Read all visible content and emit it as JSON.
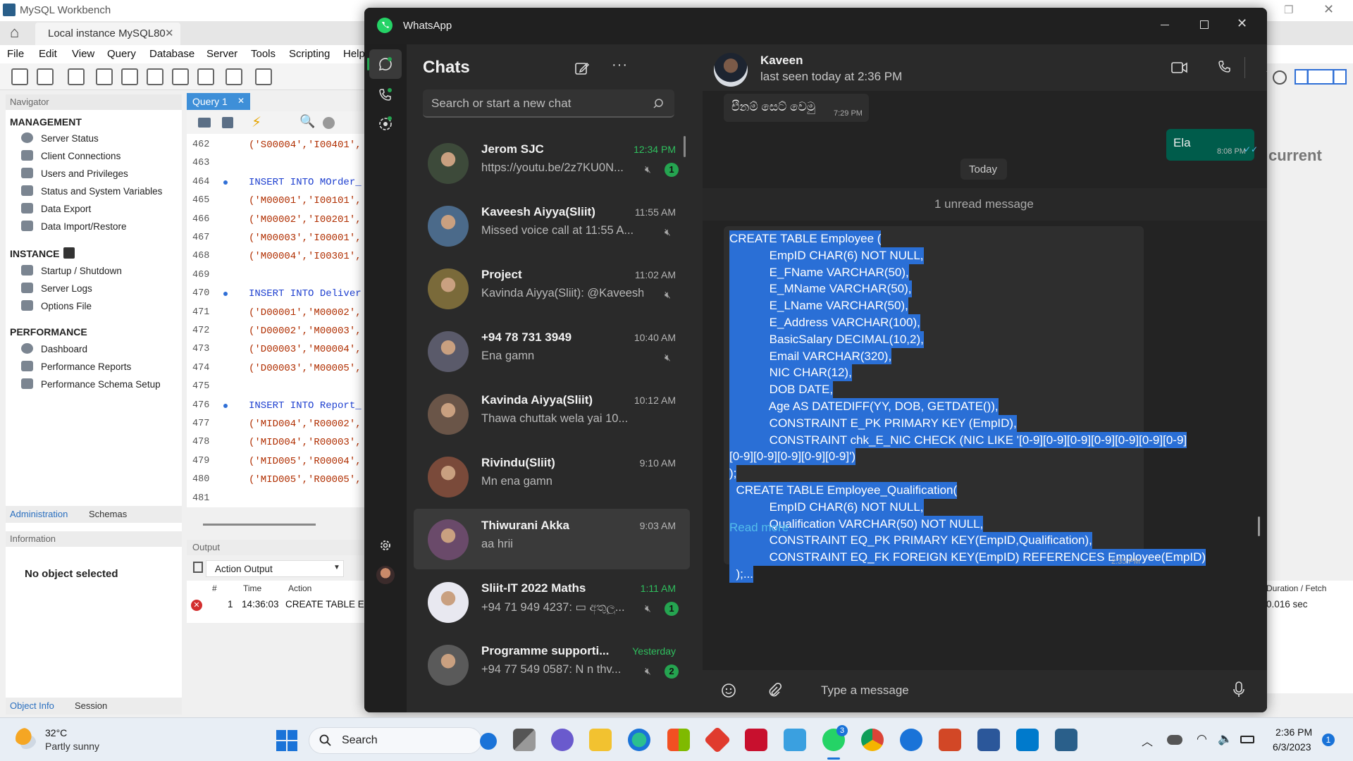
{
  "mysql": {
    "window_title": "MySQL Workbench",
    "instance_tab": "Local instance MySQL80",
    "menu": [
      "File",
      "Edit",
      "View",
      "Query",
      "Database",
      "Server",
      "Tools",
      "Scripting",
      "Help"
    ],
    "navigator_label": "Navigator",
    "query_tab": "Query 1",
    "management_header": "MANAGEMENT",
    "management_items": [
      "Server Status",
      "Client Connections",
      "Users and Privileges",
      "Status and System Variables",
      "Data Export",
      "Data Import/Restore"
    ],
    "instance_header": "INSTANCE",
    "instance_items": [
      "Startup / Shutdown",
      "Server Logs",
      "Options File"
    ],
    "performance_header": "PERFORMANCE",
    "performance_items": [
      "Dashboard",
      "Performance Reports",
      "Performance Schema Setup"
    ],
    "tabs_bottom": [
      "Administration",
      "Schemas"
    ],
    "information_label": "Information",
    "no_object": "No object selected",
    "object_tabs": [
      "Object Info",
      "Session"
    ],
    "line_numbers": [
      "462",
      "463",
      "464",
      "465",
      "466",
      "467",
      "468",
      "469",
      "470",
      "471",
      "472",
      "473",
      "474",
      "475",
      "476",
      "477",
      "478",
      "479",
      "480",
      "481"
    ],
    "code_lines": [
      "('S00004','I00401',",
      "",
      "INSERT INTO MOrder_",
      "('M00001','I00101',",
      "('M00002','I00201',",
      "('M00003','I00001',",
      "('M00004','I00301',",
      "",
      "INSERT INTO Deliver",
      "('D00001','M00002',",
      "('D00002','M00003',",
      "('D00003','M00004',",
      "('D00003','M00005',",
      "",
      "INSERT INTO Report_",
      "('MID004','R00002',",
      "('MID004','R00003',",
      "('MID005','R00004',",
      "('MID005','R00005',",
      ""
    ],
    "output_label": "Output",
    "action_output": "Action Output",
    "out_cols": [
      "#",
      "Time",
      "Action"
    ],
    "out_row": {
      "num": "1",
      "time": "14:36:03",
      "action": "CREATE TABLE E"
    },
    "right_current": "current",
    "right_duration": "Duration / Fetch",
    "right_sec": "0.016 sec"
  },
  "whatsapp": {
    "app_title": "WhatsApp",
    "chats_title": "Chats",
    "search_placeholder": "Search or start a new chat",
    "chats": [
      {
        "name": "Jerom SJC",
        "preview": "https://youtu.be/2z7KU0N...",
        "time": "12:34 PM",
        "unread": "1",
        "green": true
      },
      {
        "name": "Kaveesh Aiyya(Sliit)",
        "preview": "Missed voice call at 11:55 A...",
        "time": "11:55 AM",
        "unread": "",
        "green": false
      },
      {
        "name": "Project",
        "preview": "Kavinda Aiyya(Sliit): @Kaveesh...",
        "time": "11:02 AM",
        "unread": "",
        "green": false
      },
      {
        "name": "+94 78 731 3949",
        "preview": "Ena gamn",
        "time": "10:40 AM",
        "unread": "",
        "green": false
      },
      {
        "name": "Kavinda Aiyya(Sliit)",
        "preview": "Thawa chuttak wela yai 10...",
        "time": "10:12 AM",
        "unread": "",
        "green": false
      },
      {
        "name": "Rivindu(Sliit)",
        "preview": "Mn ena gamn",
        "time": "9:10 AM",
        "unread": "",
        "green": false
      },
      {
        "name": "Thiwurani Akka",
        "preview": "aa hrii",
        "time": "9:03 AM",
        "unread": "",
        "green": false
      },
      {
        "name": "Sliit-IT 2022 Maths",
        "preview": "+94 71 949 4237: ▭ අතුලු...",
        "time": "1:11 AM",
        "unread": "1",
        "green": true
      },
      {
        "name": "Programme supporti...",
        "preview": "+94 77 549 0587: N n thv...",
        "time": "Yesterday",
        "unread": "2",
        "green": true
      }
    ],
    "contact_name": "Kaveen",
    "contact_status": "last seen today at 2:36 PM",
    "msg_in_text": "එිනම් සෙට් වෙමු",
    "msg_in_time": "7:29 PM",
    "msg_out_text": "Ela",
    "msg_out_time": "8:08 PM",
    "today_label": "Today",
    "unread_label": "1 unread message",
    "sql_lines": [
      "CREATE TABLE Employee (",
      "            EmpID CHAR(6) NOT NULL,",
      "            E_FName VARCHAR(50),",
      "            E_MName VARCHAR(50),",
      "            E_LName VARCHAR(50),",
      "            E_Address VARCHAR(100),",
      "            BasicSalary DECIMAL(10,2),",
      "            Email VARCHAR(320),",
      "            NIC CHAR(12),",
      "            DOB DATE,",
      "            Age AS DATEDIFF(YY, DOB, GETDATE()),",
      "            CONSTRAINT E_PK PRIMARY KEY (EmpID),",
      "            CONSTRAINT chk_E_NIC CHECK (NIC LIKE '[0-9][0-9][0-9][0-9][0-9][0-9][0-9]",
      "[0-9][0-9][0-9][0-9][0-9]')",
      ");",
      "  CREATE TABLE Employee_Qualification(",
      "            EmpID CHAR(6) NOT NULL,",
      "            Qualification VARCHAR(50) NOT NULL,",
      "            CONSTRAINT EQ_PK PRIMARY KEY(EmpID,Qualification),",
      "            CONSTRAINT EQ_FK FOREIGN KEY(EmpID) REFERENCES Employee(EmpID)",
      "  );..."
    ],
    "read_more": "Read more",
    "msg_long_time": "2:35 PM",
    "composer_placeholder": "Type a message"
  },
  "taskbar": {
    "weather_temp": "32°C",
    "weather_desc": "Partly sunny",
    "search_label": "Search",
    "wa_badge": "3",
    "clock_time": "2:36 PM",
    "clock_date": "6/3/2023",
    "notif": "1"
  },
  "colors": {
    "wa_green": "#25a450",
    "selection_blue": "#2a6fd6",
    "wa_bg": "#1f1f1f",
    "out_bubble": "#005c4b"
  }
}
